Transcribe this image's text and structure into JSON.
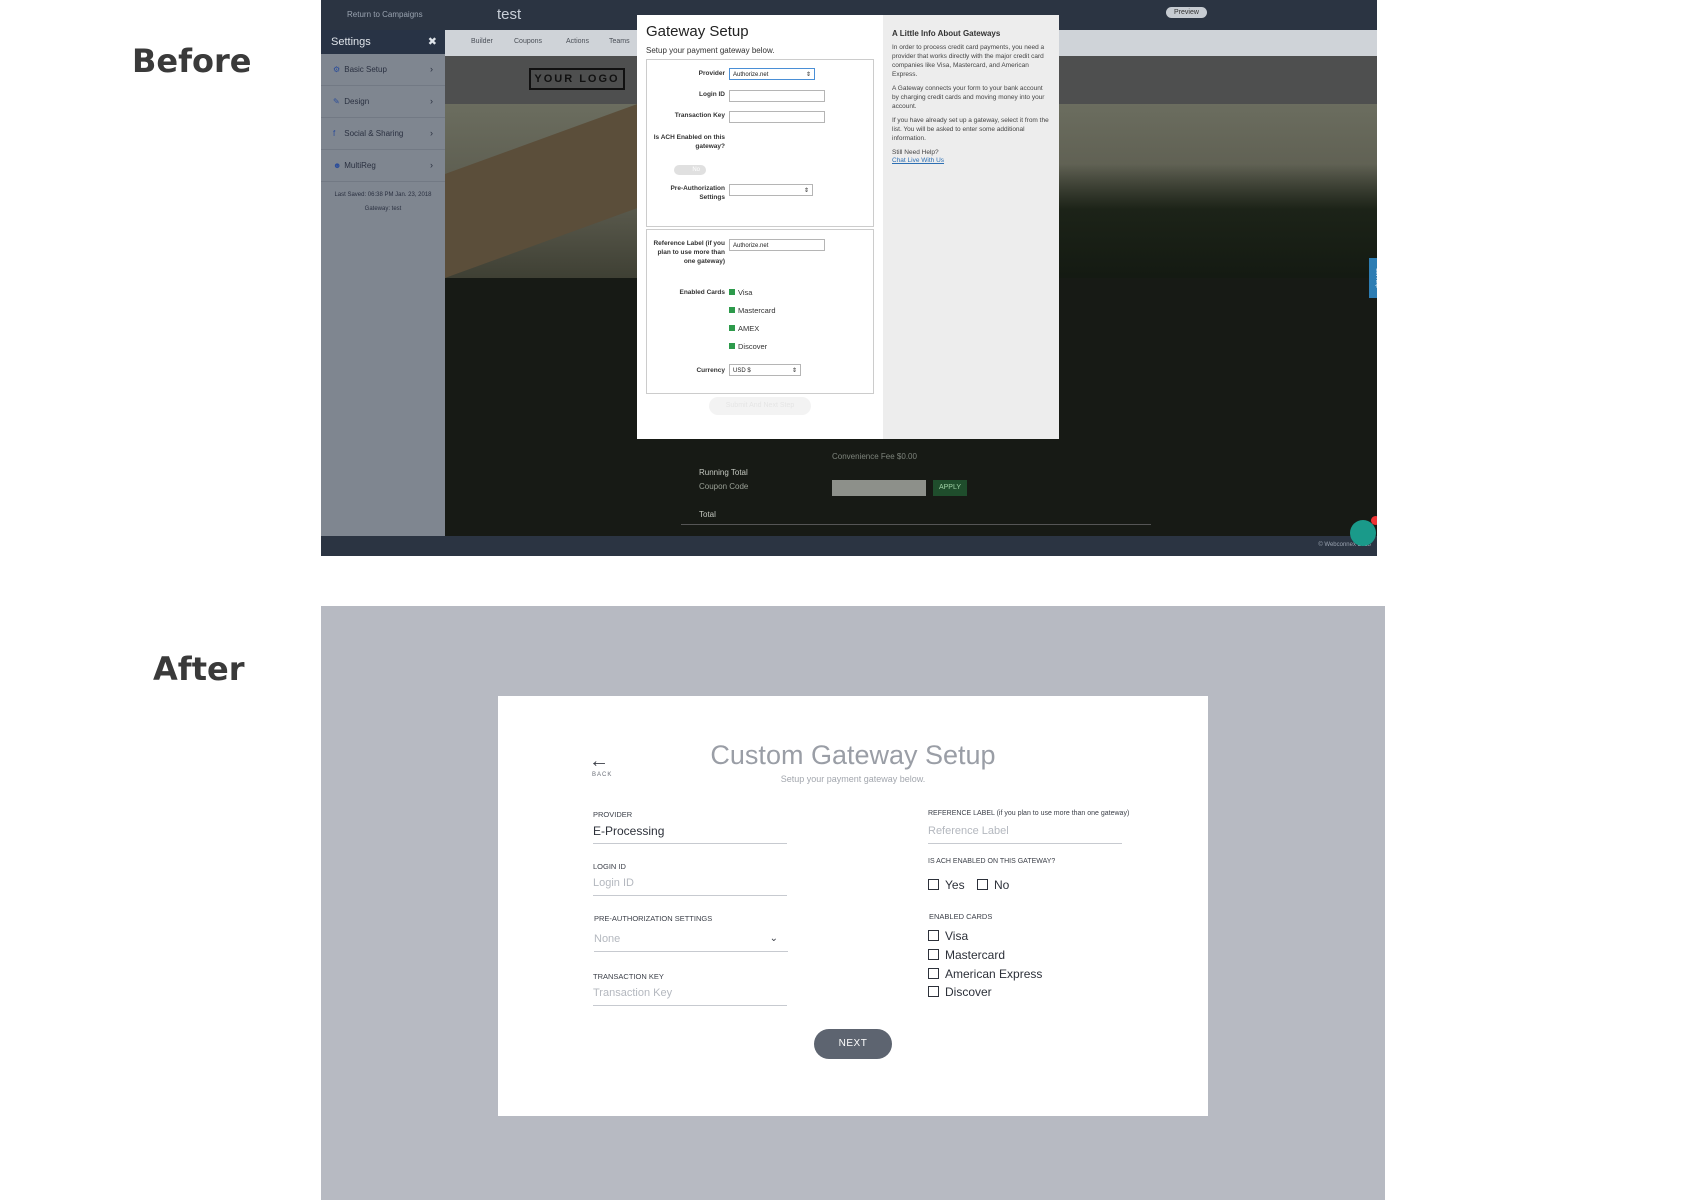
{
  "labels": {
    "before": "Before",
    "after": "After"
  },
  "before": {
    "topbar": {
      "return": "Return to Campaigns",
      "campaign": "test",
      "preview": "Preview"
    },
    "nav": [
      "Builder",
      "Coupons",
      "Actions",
      "Teams"
    ],
    "sidebar": {
      "title": "Settings",
      "items": [
        {
          "label": "Basic Setup",
          "icon": "gear-icon"
        },
        {
          "label": "Design",
          "icon": "brush-icon"
        },
        {
          "label": "Social & Sharing",
          "icon": "facebook-icon"
        },
        {
          "label": "MultiReg",
          "icon": "users-icon"
        }
      ],
      "last_saved": "Last Saved: 06:38 PM Jan. 23, 2018",
      "gateway": "Gateway: test"
    },
    "logo": "YOUR LOGO",
    "modal": {
      "title": "Gateway Setup",
      "subtitle": "Setup your payment gateway below.",
      "provider_label": "Provider",
      "provider_value": "Authorize.net",
      "login_label": "Login ID",
      "txkey_label": "Transaction Key",
      "ach_label": "Is ACH Enabled on this gateway?",
      "ach_value": "No",
      "preauth_label": "Pre-Authorization Settings",
      "ref_label": "Reference Label (if you plan to use more than one gateway)",
      "ref_value": "Authorize.net",
      "cards_label": "Enabled Cards",
      "cards": [
        "Visa",
        "Mastercard",
        "AMEX",
        "Discover"
      ],
      "currency_label": "Currency",
      "currency_value": "USD $",
      "submit": "Submit And Next Step",
      "info_title": "A Little Info About Gateways",
      "info_paras": [
        "In order to process credit card payments, you need a provider that works directly with the major credit card companies like Visa, Mastercard, and American Express.",
        "A Gateway connects your form to your bank account by charging credit cards and moving money into your account.",
        "If you have already set up a gateway, select it from the list. You will be asked to enter some additional information.",
        "Still Need Help?"
      ],
      "info_link": "Chat Live With Us"
    },
    "checkout": {
      "fee": "Convenience Fee $0.00",
      "running_total": "Running Total",
      "coupon_code": "Coupon Code",
      "apply": "APPLY",
      "total": "Total"
    },
    "get_help": "Get Help",
    "copyright": "© Webconnex 2018"
  },
  "after": {
    "back": "BACK",
    "title": "Custom Gateway Setup",
    "subtitle": "Setup your payment gateway below.",
    "provider_label": "PROVIDER",
    "provider_value": "E-Processing",
    "login_label": "LOGIN ID",
    "login_placeholder": "Login ID",
    "preauth_label": "PRE-AUTHORIZATION SETTINGS",
    "preauth_value": "None",
    "txkey_label": "TRANSACTION KEY",
    "txkey_placeholder": "Transaction Key",
    "ref_label": "REFERENCE LABEL (if you plan to use more than one gateway)",
    "ref_placeholder": "Reference Label",
    "ach_label": "IS ACH ENABLED ON THIS GATEWAY?",
    "ach_options": [
      "Yes",
      "No"
    ],
    "cards_label": "ENABLED CARDS",
    "cards": [
      "Visa",
      "Mastercard",
      "American Express",
      "Discover"
    ],
    "next": "NEXT"
  },
  "colors": {
    "after_bg": "#b7bac2",
    "next_button": "#5d6470",
    "before_topbar": "#2b3442"
  }
}
